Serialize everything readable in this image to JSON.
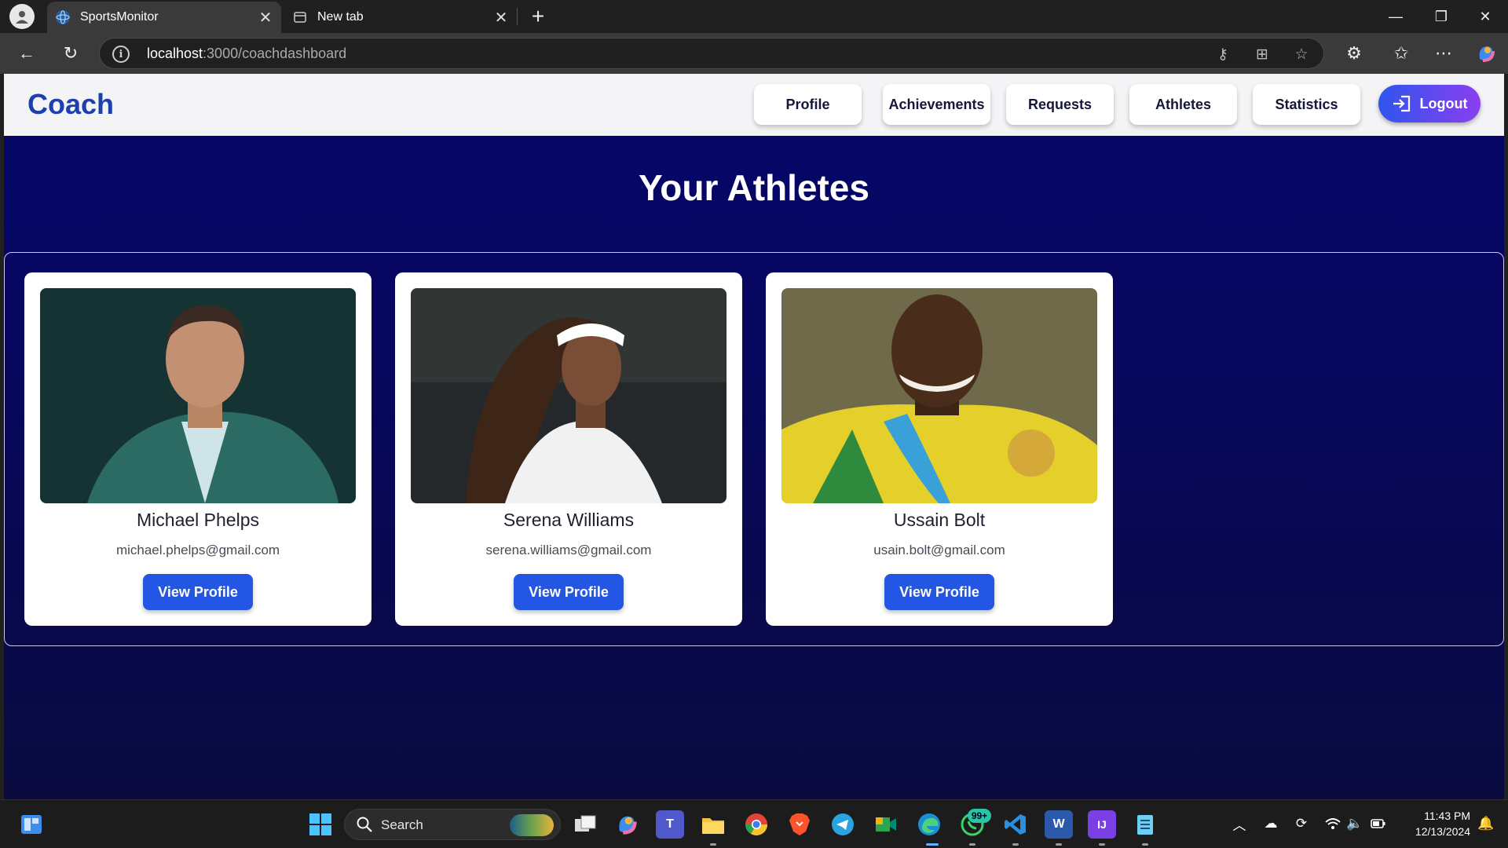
{
  "browser": {
    "tabs": [
      {
        "title": "SportsMonitor",
        "active": true
      },
      {
        "title": "New tab",
        "active": false
      }
    ],
    "address": {
      "host": "localhost",
      "path": ":3000/coachdashboard"
    }
  },
  "app": {
    "brand": "Coach",
    "nav": [
      "Profile",
      "Achievements",
      "Requests",
      "Athletes",
      "Statistics"
    ],
    "logout": "Logout",
    "heading": "Your Athletes",
    "athletes": [
      {
        "name": "Michael Phelps",
        "email": "michael.phelps@gmail.com",
        "button": "View Profile"
      },
      {
        "name": "Serena Williams",
        "email": "serena.williams@gmail.com",
        "button": "View Profile"
      },
      {
        "name": "Ussain Bolt",
        "email": "usain.bolt@gmail.com",
        "button": "View Profile"
      }
    ]
  },
  "taskbar": {
    "search_label": "Search",
    "whatsapp_badge": "99+",
    "time": "11:43 PM",
    "date": "12/13/2024"
  },
  "colors": {
    "brand": "#1e40af",
    "page_bg": "#07075e",
    "view_button": "#2456e4",
    "logout_start": "#2e56ee",
    "logout_end": "#8b3ef0"
  }
}
